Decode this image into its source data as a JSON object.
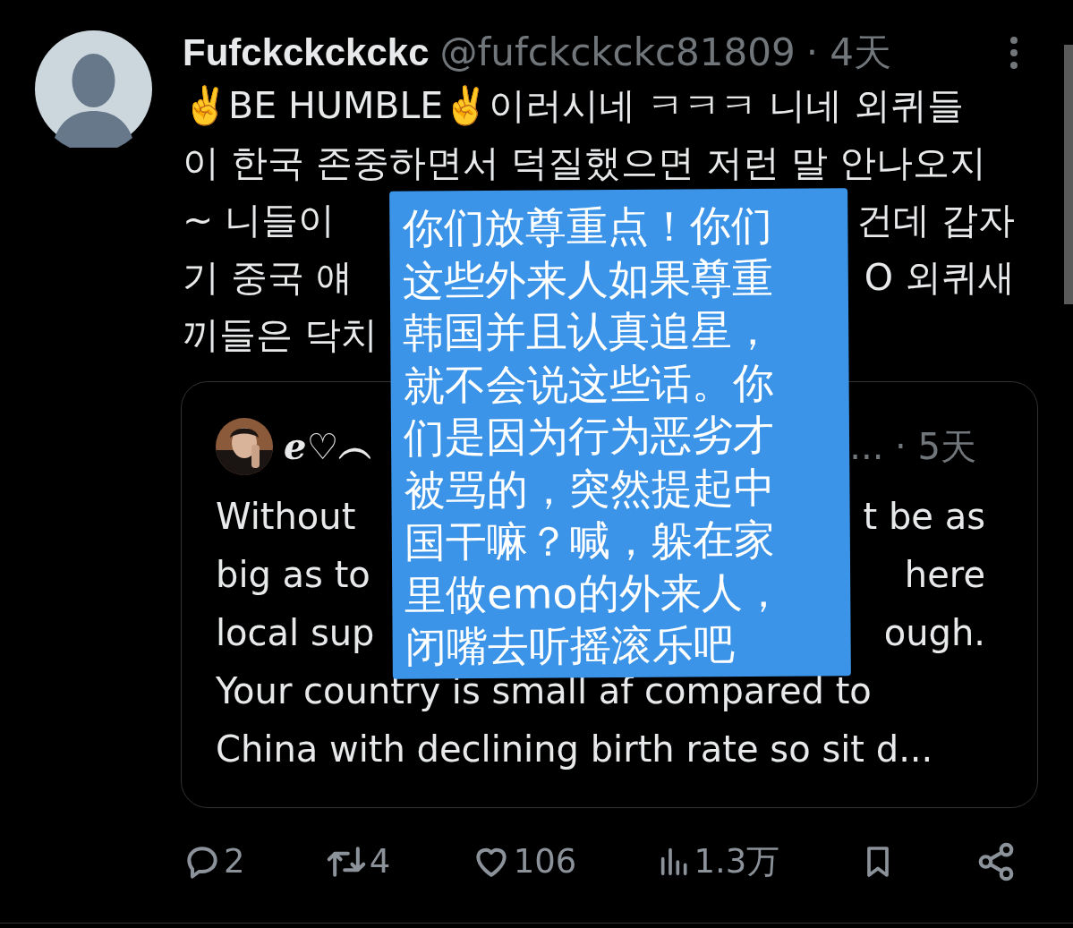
{
  "tweet": {
    "name": "Fufckckckckc",
    "handle": "@fufckckckc81809",
    "time": "· 4天",
    "lines": [
      {
        "left": "✌️BE HUMBLE✌️이러시네 ㅋㅋㅋ 니네 외퀴들"
      },
      {
        "left": "이 한국 존중하면서 덕질했으면 저런 말 안나오지"
      },
      {
        "left": "~ 니들이",
        "right": "건데 갑자"
      },
      {
        "left": "기 중국 얘",
        "right": "O 외퀴새"
      },
      {
        "left": "끼들은 닥치"
      }
    ],
    "quote": {
      "name": "ℯ♡︵",
      "time": "... · 5天",
      "lines": [
        {
          "left": "Without",
          "right": "t be as"
        },
        {
          "left": "big as to",
          "right": "here"
        },
        {
          "left": "local sup",
          "right": "ough."
        },
        {
          "left": "Your country is small af compared to"
        },
        {
          "left": "China with declining birth rate so sit d..."
        }
      ]
    },
    "actions": [
      {
        "kind": "reply",
        "count": "2"
      },
      {
        "kind": "repost",
        "count": "4"
      },
      {
        "kind": "like",
        "count": "106"
      },
      {
        "kind": "views",
        "count": "1.3万"
      },
      {
        "kind": "bookmark"
      },
      {
        "kind": "share"
      }
    ]
  },
  "note": {
    "lines": [
      "你们放尊重点！你们",
      "这些外来人如果尊重",
      "韩国并且认真追星，",
      "就不会说这些话。你",
      "们是因为行为恶劣才",
      "被骂的，突然提起中",
      "国干嘛？喊，躲在家",
      "里做emo的外来人，",
      "闭嘴去听摇滚乐吧"
    ]
  }
}
